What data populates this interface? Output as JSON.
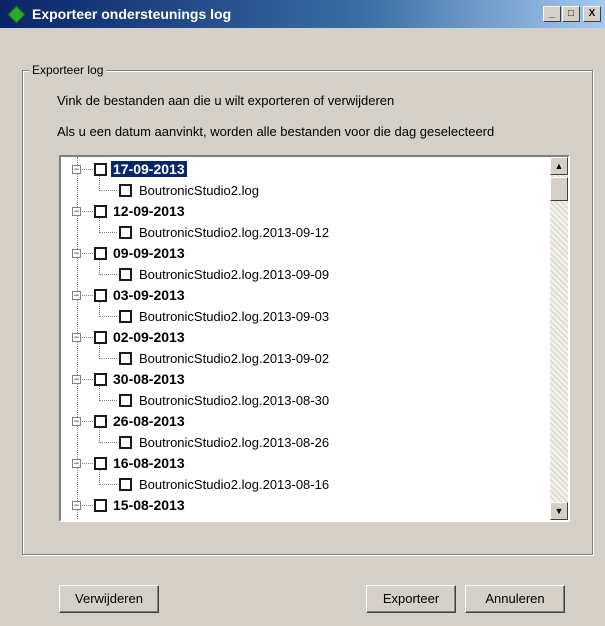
{
  "window": {
    "title": "Exporteer ondersteunings log",
    "controls": {
      "minimize": "_",
      "maximize": "□",
      "close": "X"
    }
  },
  "group": {
    "legend": "Exporteer log",
    "instruction_1": "Vink de bestanden aan die u wilt exporteren of verwijderen",
    "instruction_2": "Als u een datum aanvinkt, worden alle bestanden voor die dag geselecteerd"
  },
  "tree": {
    "selected_index": 0,
    "nodes": [
      {
        "date": "17-09-2013",
        "file": "BoutronicStudio2.log",
        "checked": false,
        "expanded": true
      },
      {
        "date": "12-09-2013",
        "file": "BoutronicStudio2.log.2013-09-12",
        "checked": false,
        "expanded": true
      },
      {
        "date": "09-09-2013",
        "file": "BoutronicStudio2.log.2013-09-09",
        "checked": false,
        "expanded": true
      },
      {
        "date": "03-09-2013",
        "file": "BoutronicStudio2.log.2013-09-03",
        "checked": false,
        "expanded": true
      },
      {
        "date": "02-09-2013",
        "file": "BoutronicStudio2.log.2013-09-02",
        "checked": false,
        "expanded": true
      },
      {
        "date": "30-08-2013",
        "file": "BoutronicStudio2.log.2013-08-30",
        "checked": false,
        "expanded": true
      },
      {
        "date": "26-08-2013",
        "file": "BoutronicStudio2.log.2013-08-26",
        "checked": false,
        "expanded": true
      },
      {
        "date": "16-08-2013",
        "file": "BoutronicStudio2.log.2013-08-16",
        "checked": false,
        "expanded": true
      },
      {
        "date": "15-08-2013",
        "file": "",
        "checked": false,
        "expanded": true
      }
    ],
    "expander_glyph": "−",
    "scroll_up_glyph": "▲",
    "scroll_down_glyph": "▼"
  },
  "buttons": {
    "delete": "Verwijderen",
    "export": "Exporteer",
    "cancel": "Annuleren"
  },
  "colors": {
    "face": "#d4d0c8",
    "title_start": "#0a246a",
    "title_end": "#a6caf0",
    "selection": "#0a246a"
  },
  "icons": {
    "app": "green-diamond-icon"
  }
}
